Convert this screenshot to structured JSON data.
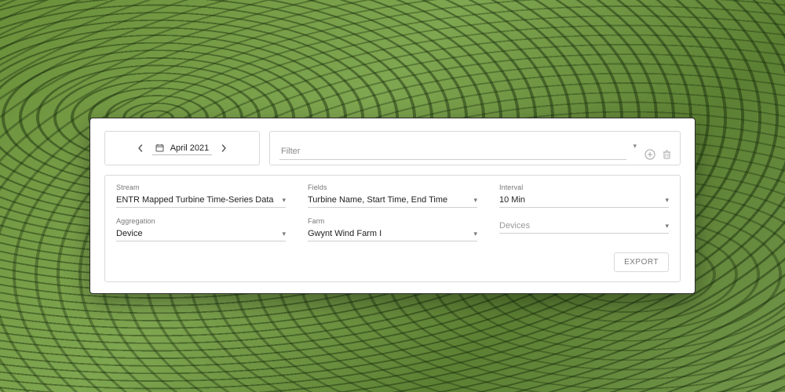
{
  "date_nav": {
    "label": "April 2021"
  },
  "filter": {
    "placeholder": "Filter"
  },
  "fields": {
    "stream": {
      "label": "Stream",
      "value": "ENTR Mapped Turbine Time-Series Data"
    },
    "fields": {
      "label": "Fields",
      "value": "Turbine Name, Start Time, End Time"
    },
    "interval": {
      "label": "Interval",
      "value": "10 Min"
    },
    "aggregation": {
      "label": "Aggregation",
      "value": "Device"
    },
    "farm": {
      "label": "Farm",
      "value": "Gwynt Wind Farm I"
    },
    "devices": {
      "label": "",
      "value": "Devices"
    }
  },
  "buttons": {
    "export": "EXPORT"
  }
}
